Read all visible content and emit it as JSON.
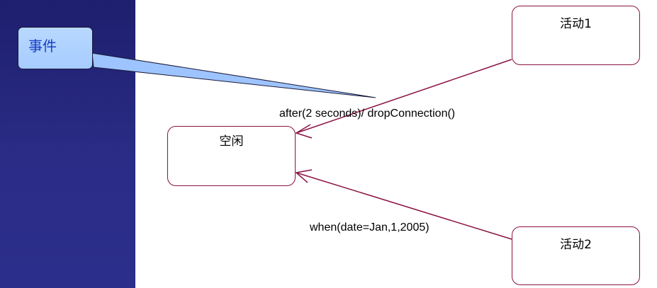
{
  "callout": {
    "label": "事件"
  },
  "states": {
    "idle": "空闲",
    "active1": "活动1",
    "active2": "活动2"
  },
  "transitions": {
    "timeout": "after(2 seconds)/ dropConnection()",
    "date": "when(date=Jan,1,2005)"
  },
  "colors": {
    "sidebar": "#2a2c86",
    "callout_fill": "#a6ccff",
    "callout_text": "#1a3fc4",
    "state_border": "#8a1144",
    "transition_line": "#8a1144"
  }
}
